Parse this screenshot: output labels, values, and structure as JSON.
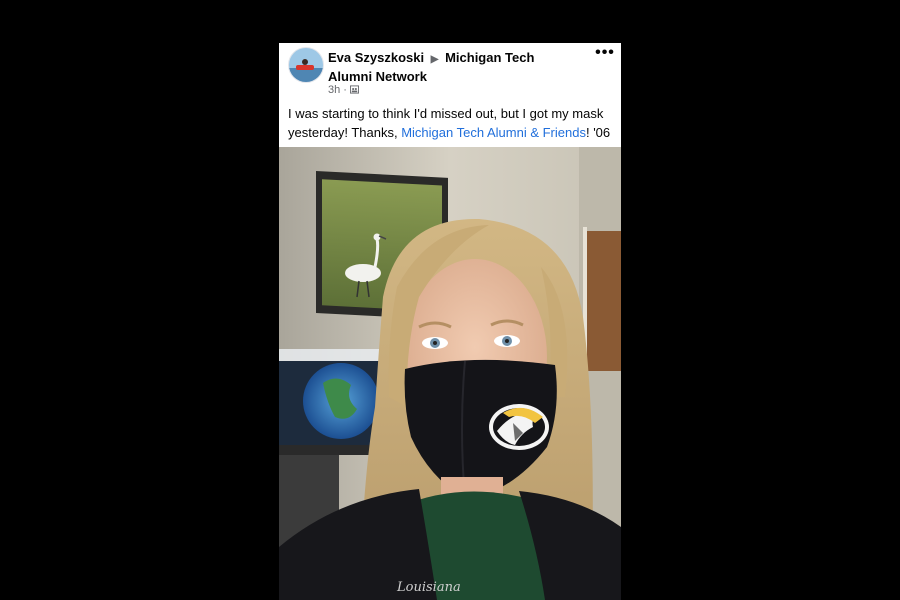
{
  "post": {
    "author": "Eva Szyszkoski",
    "separator_icon": "triangle-right-icon",
    "group": "Michigan Tech Alumni Network",
    "time": "3h",
    "dot": "·",
    "audience_icon": "group-audience-icon",
    "more_label": "•••",
    "text_before": "I was starting to think I'd missed out, but I got my mask yesterday! Thanks, ",
    "mention": "Michigan Tech Alumni & Friends",
    "text_after": "! '06"
  },
  "photo": {
    "shirt_text": "Louisiana"
  },
  "colors": {
    "background": "#000000",
    "card": "#ffffff",
    "link": "#216fdb",
    "mask": "#141418",
    "logo_gold": "#f2c440",
    "shirt_green": "#1e4a30"
  }
}
